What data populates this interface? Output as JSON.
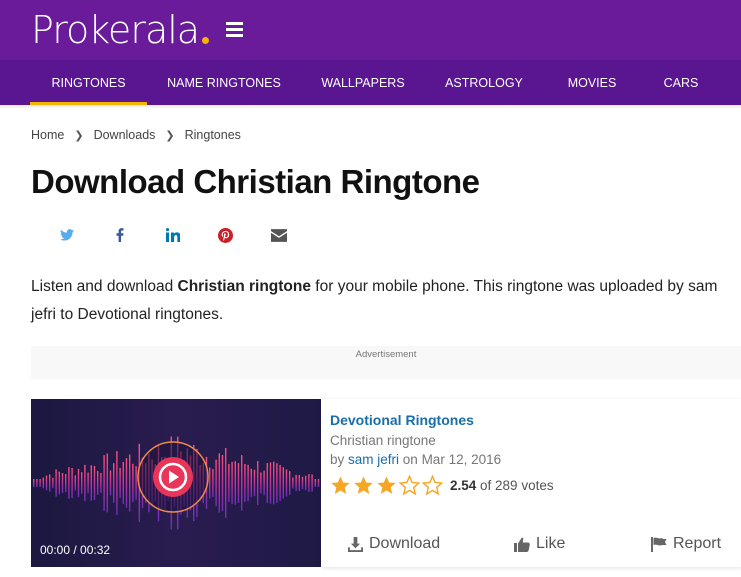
{
  "header": {
    "logo_text": "Prokerala",
    "menu_icon": "hamburger-icon"
  },
  "nav": {
    "items": [
      {
        "label": "RINGTONES",
        "active": true
      },
      {
        "label": "NAME RINGTONES",
        "active": false
      },
      {
        "label": "WALLPAPERS",
        "active": false
      },
      {
        "label": "ASTROLOGY",
        "active": false
      },
      {
        "label": "MOVIES",
        "active": false
      },
      {
        "label": "CARS",
        "active": false
      }
    ]
  },
  "breadcrumb": {
    "items": [
      "Home",
      "Downloads",
      "Ringtones"
    ],
    "separator_icon": "chevron-right-icon"
  },
  "page": {
    "title": "Download Christian Ringtone",
    "description_prefix": "Listen and download ",
    "description_bold": "Christian ringtone",
    "description_suffix": " for your mobile phone. This ringtone was uploaded by sam jefri to Devotional ringtones."
  },
  "share": {
    "icons": [
      "twitter-icon",
      "facebook-icon",
      "linkedin-icon",
      "pinterest-icon",
      "email-icon"
    ],
    "colors": {
      "twitter": "#55acee",
      "facebook": "#3b5998",
      "linkedin": "#0077b5",
      "pinterest": "#cb2027",
      "email": "#555555"
    }
  },
  "ad": {
    "label": "Advertisement"
  },
  "ringtone": {
    "category": "Devotional Ringtones",
    "name": "Christian ringtone",
    "by_prefix": "by ",
    "uploader": "sam jefri",
    "date_prefix": " on ",
    "date": "Mar 12, 2016",
    "rating": 2.54,
    "rating_display": "2.54",
    "stars_filled": 3,
    "stars_total": 5,
    "votes_text": " of 289 votes",
    "player": {
      "current_time": "00:00",
      "duration": "00:32",
      "time_display": "00:00 / 00:32"
    },
    "actions": {
      "download": "Download",
      "like": "Like",
      "report": "Report"
    }
  },
  "colors": {
    "header_bg": "#6a1b9a",
    "nav_bg": "#5a1591",
    "accent": "#f4b400",
    "link": "#1a6ea8",
    "play_button": "#e8365a",
    "star": "#f5a623"
  }
}
